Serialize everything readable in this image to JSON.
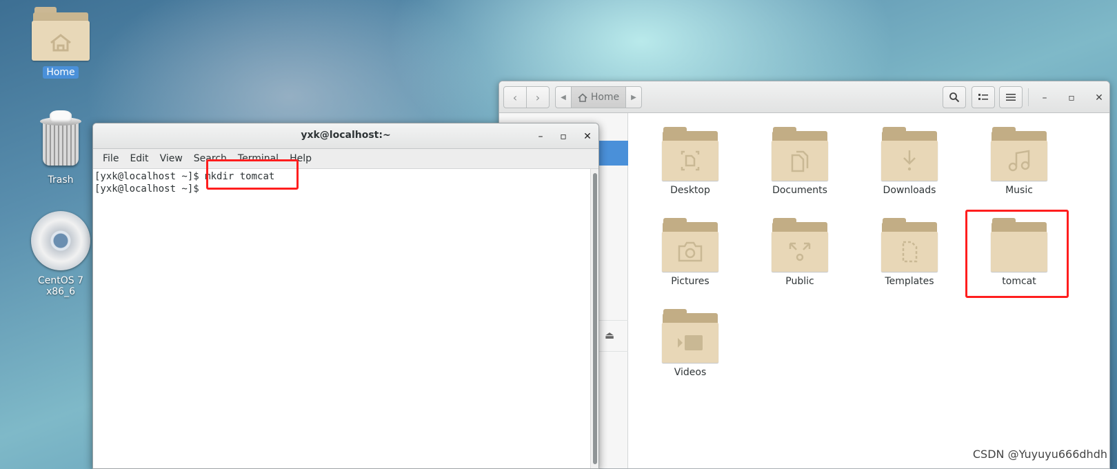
{
  "desktop": {
    "icons": [
      {
        "label": "Home",
        "icon": "home-folder-icon"
      },
      {
        "label": "Trash",
        "icon": "trash-icon"
      },
      {
        "label": "CentOS 7 x86_6",
        "icon": "optical-disc-icon"
      }
    ]
  },
  "file_manager": {
    "location_label": "Home",
    "items": [
      {
        "name": "Desktop",
        "icon": "desktop-folder-icon"
      },
      {
        "name": "Documents",
        "icon": "documents-folder-icon"
      },
      {
        "name": "Downloads",
        "icon": "downloads-folder-icon"
      },
      {
        "name": "Music",
        "icon": "music-folder-icon"
      },
      {
        "name": "Pictures",
        "icon": "pictures-folder-icon"
      },
      {
        "name": "Public",
        "icon": "public-folder-icon"
      },
      {
        "name": "Templates",
        "icon": "templates-folder-icon"
      },
      {
        "name": "tomcat",
        "icon": "folder-icon"
      },
      {
        "name": "Videos",
        "icon": "videos-folder-icon"
      }
    ],
    "highlighted_item": "tomcat"
  },
  "terminal": {
    "title": "yxk@localhost:~",
    "menu": [
      "File",
      "Edit",
      "View",
      "Search",
      "Terminal",
      "Help"
    ],
    "lines": [
      {
        "prompt": "[yxk@localhost ~]$ ",
        "command": "mkdir tomcat"
      },
      {
        "prompt": "[yxk@localhost ~]$ ",
        "command": ""
      }
    ]
  },
  "watermark": "CSDN @Yuyuyu666dhdh",
  "colors": {
    "selection": "#4a90d9",
    "annotation_red": "#ff1e1e",
    "folder": "#e8d7b7"
  }
}
